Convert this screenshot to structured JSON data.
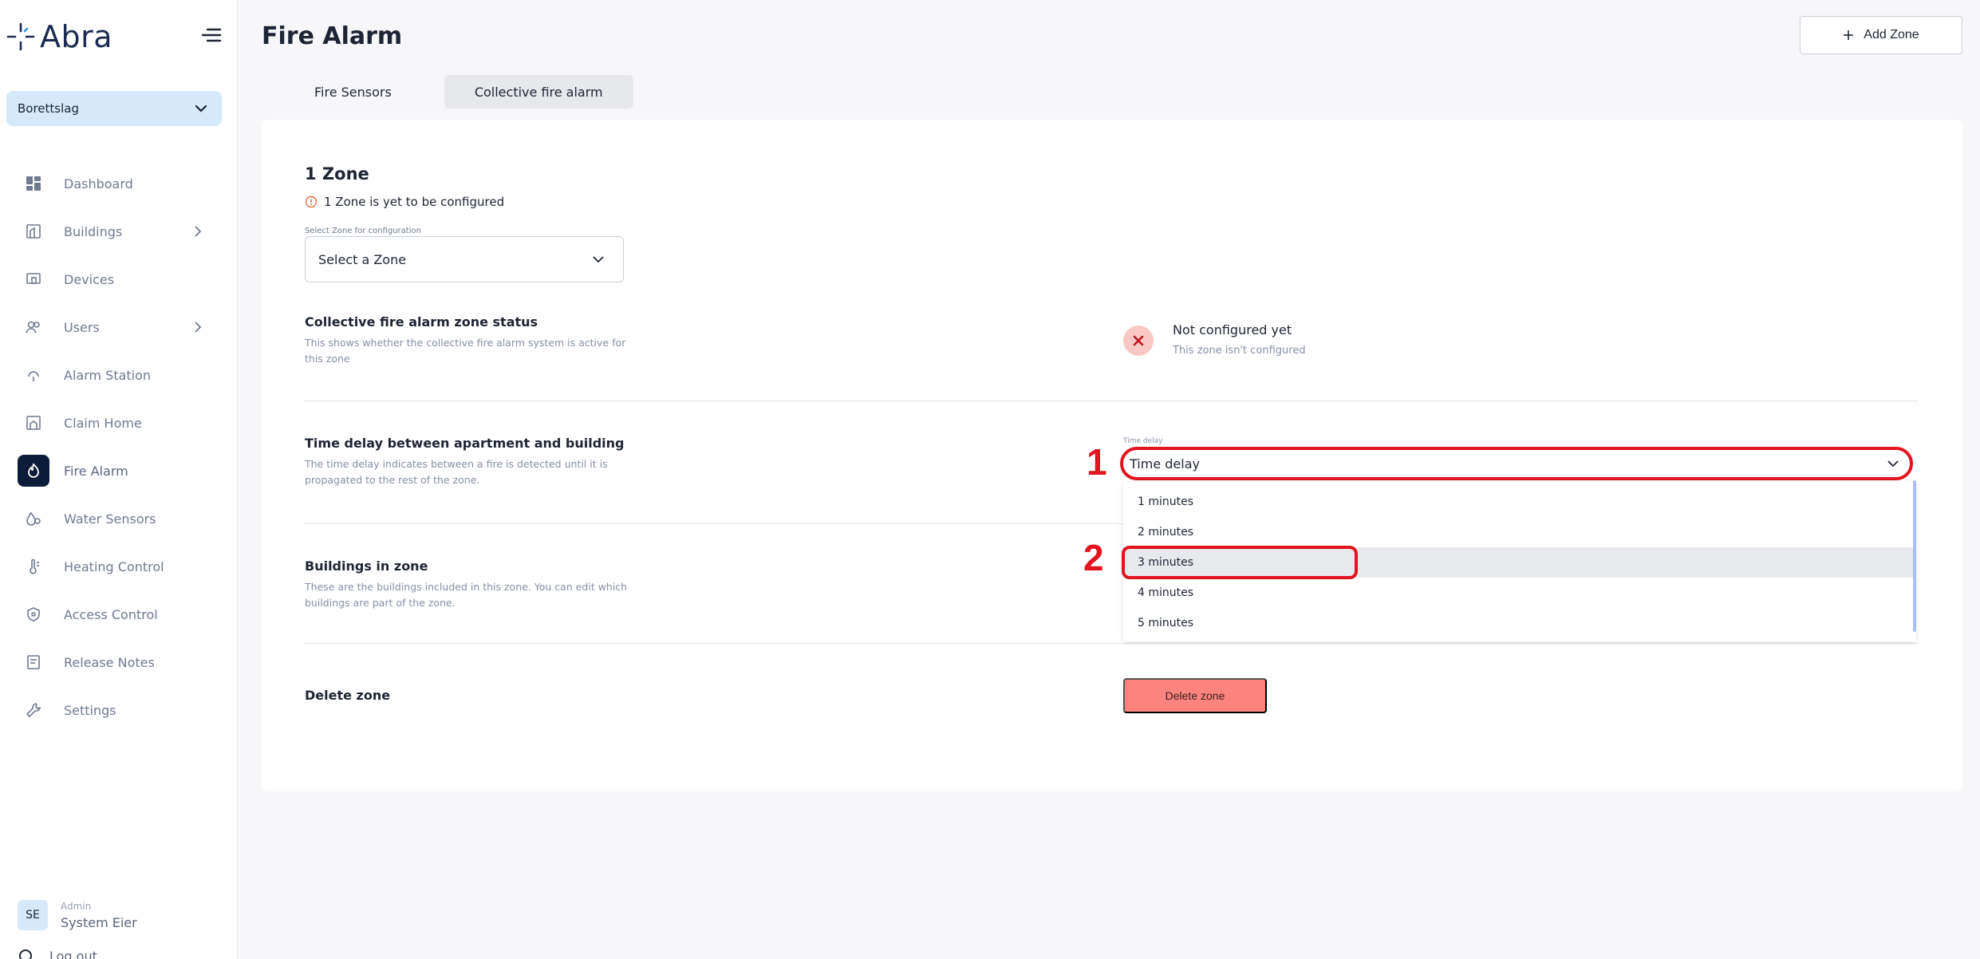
{
  "app": {
    "logo_text": "Abra"
  },
  "sidebar": {
    "org": "Borettslag",
    "items": [
      {
        "label": "Dashboard",
        "icon": "dashboard-icon"
      },
      {
        "label": "Buildings",
        "icon": "building-icon",
        "has_submenu": true
      },
      {
        "label": "Devices",
        "icon": "devices-icon"
      },
      {
        "label": "Users",
        "icon": "users-icon",
        "has_submenu": true
      },
      {
        "label": "Alarm Station",
        "icon": "alarm-station-icon"
      },
      {
        "label": "Claim Home",
        "icon": "home-icon"
      },
      {
        "label": "Fire Alarm",
        "icon": "fire-icon",
        "active": true
      },
      {
        "label": "Water Sensors",
        "icon": "water-icon"
      },
      {
        "label": "Heating Control",
        "icon": "thermometer-icon"
      },
      {
        "label": "Access Control",
        "icon": "shield-icon"
      },
      {
        "label": "Release Notes",
        "icon": "notes-icon"
      },
      {
        "label": "Settings",
        "icon": "wrench-icon"
      }
    ],
    "user": {
      "initials": "SE",
      "role": "Admin",
      "name": "System Eier"
    },
    "logout": "Log out"
  },
  "header": {
    "title": "Fire Alarm",
    "add_zone": "Add Zone"
  },
  "tabs": [
    {
      "label": "Fire Sensors",
      "active": false
    },
    {
      "label": "Collective fire alarm",
      "active": true
    }
  ],
  "zone": {
    "title": "1 Zone",
    "warning": "1 Zone is yet to be configured",
    "select_label": "Select Zone for configuration",
    "select_value": "Select a Zone"
  },
  "status_section": {
    "title": "Collective fire alarm zone status",
    "description": "This shows whether the collective fire alarm system is active for this zone",
    "status_title": "Not configured yet",
    "status_sub": "This zone isn't configured"
  },
  "delay_section": {
    "title": "Time delay between apartment and building",
    "description": "The time delay indicates between a fire is detected until it is propagated to the rest of the zone.",
    "field_label": "Time delay",
    "field_value": "Time delay",
    "options": [
      "1 minutes",
      "2 minutes",
      "3 minutes",
      "4 minutes",
      "5 minutes"
    ],
    "highlighted_option": "3 minutes"
  },
  "buildings_section": {
    "title": "Buildings in zone",
    "description": "These are the buildings included in this zone. You can edit which buildings are part of the zone."
  },
  "delete_section": {
    "title": "Delete zone",
    "button": "Delete zone"
  },
  "annotations": {
    "step1": "1",
    "step2": "2",
    "color": "#e3141f"
  },
  "colors": {
    "navy": "#0d1b3a",
    "accent_light": "#d6e9fa",
    "danger": "#fd847e"
  }
}
